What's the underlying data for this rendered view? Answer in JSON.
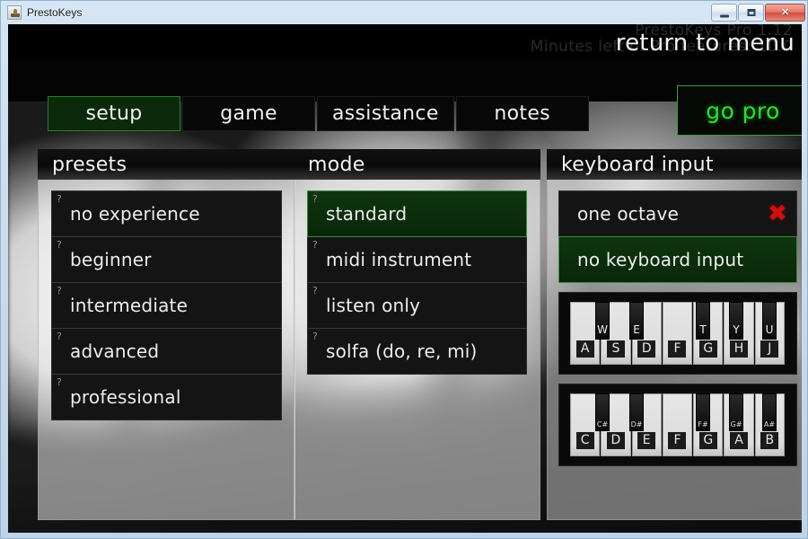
{
  "window": {
    "title": "PrestoKeys",
    "app_icon": "piano-app-icon",
    "controls": {
      "minimize": "minimize-icon",
      "maximize": "maximize-icon",
      "close": "✕"
    }
  },
  "topbar": {
    "return_label": "return to menu",
    "ghost_line_1": "PrestoKeys Pro 1.12",
    "ghost_line_2": "Minutes left of Pro features: 10.0"
  },
  "tabs": [
    {
      "label": "setup",
      "active": true
    },
    {
      "label": "game",
      "active": false
    },
    {
      "label": "assistance",
      "active": false
    },
    {
      "label": "notes",
      "active": false
    }
  ],
  "go_pro": {
    "label": "go pro",
    "color": "#2fdd2f"
  },
  "panels": {
    "presets": {
      "title": "presets",
      "options": [
        {
          "label": "no experience",
          "selected": false,
          "help": "?"
        },
        {
          "label": "beginner",
          "selected": false,
          "help": "?"
        },
        {
          "label": "intermediate",
          "selected": false,
          "help": "?"
        },
        {
          "label": "advanced",
          "selected": false,
          "help": "?"
        },
        {
          "label": "professional",
          "selected": false,
          "help": "?"
        }
      ]
    },
    "mode": {
      "title": "mode",
      "options": [
        {
          "label": "standard",
          "selected": true,
          "help": "?"
        },
        {
          "label": "midi instrument",
          "selected": false,
          "help": "?"
        },
        {
          "label": "listen only",
          "selected": false,
          "help": "?"
        },
        {
          "label": "solfa (do, re, mi)",
          "selected": false,
          "help": "?"
        }
      ]
    },
    "keyboard_input": {
      "title": "keyboard input",
      "options": [
        {
          "label": "one octave",
          "selected": false,
          "badge": "✖"
        },
        {
          "label": "no keyboard input",
          "selected": true,
          "badge": ""
        }
      ],
      "keyboards": [
        {
          "name": "computer-key-map",
          "white_keys": [
            "A",
            "S",
            "D",
            "F",
            "G",
            "H",
            "J"
          ],
          "black_keys": [
            "W",
            "E",
            null,
            "T",
            "Y",
            "U",
            null
          ]
        },
        {
          "name": "note-name-map",
          "white_keys": [
            "C",
            "D",
            "E",
            "F",
            "G",
            "A",
            "B"
          ],
          "black_keys": [
            "C#",
            "D#",
            null,
            "F#",
            "G#",
            "A#",
            null
          ]
        }
      ]
    }
  },
  "colors": {
    "accent_green": "#2fdd2f",
    "select_green_border": "#3c8a3c",
    "select_green_fill": "#0e350e",
    "danger_red": "#cc1111",
    "panel_black": "#141414"
  }
}
